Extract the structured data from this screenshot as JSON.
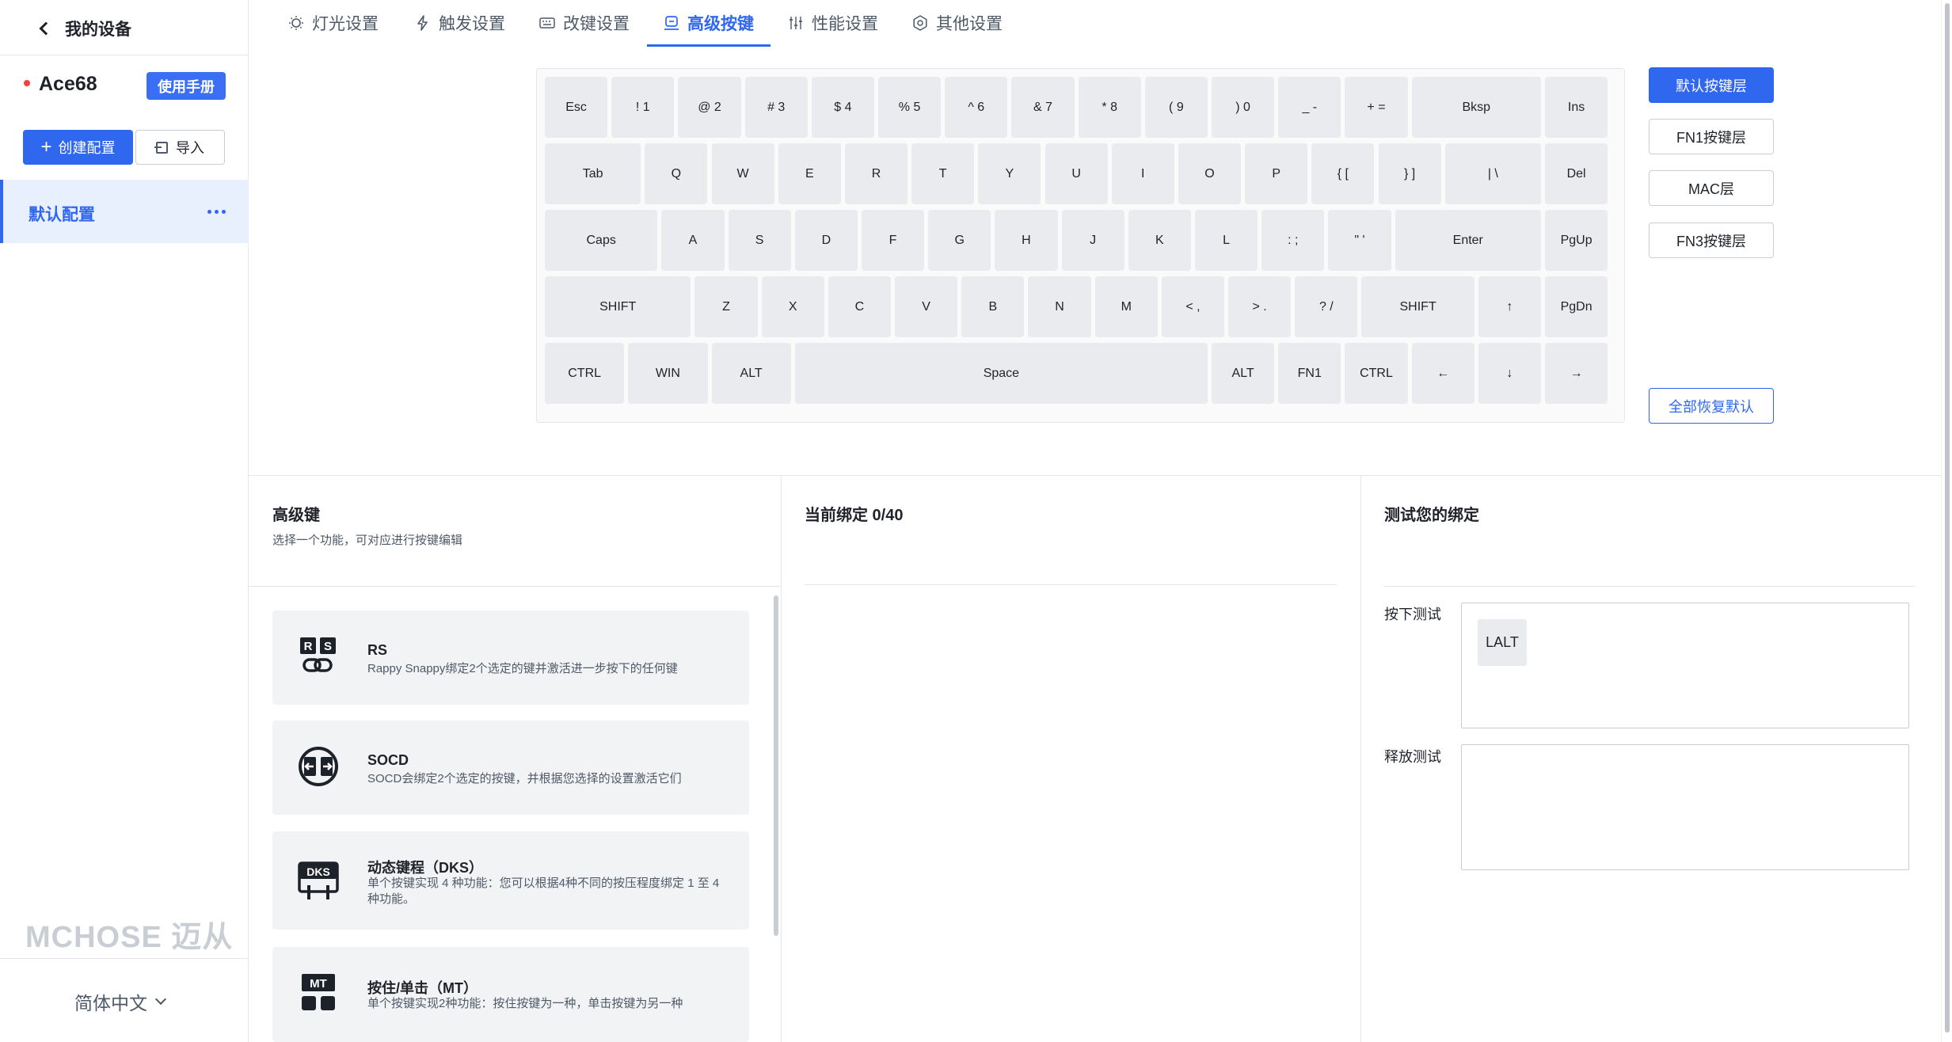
{
  "sidebar": {
    "back_label": "我的设备",
    "device_name": "Ace68",
    "manual_label": "使用手册",
    "create_label": "创建配置",
    "import_label": "导入",
    "config_item_label": "默认配置",
    "brand": "MCHOSE 迈从",
    "language": "简体中文"
  },
  "tabs": [
    {
      "label": "灯光设置",
      "icon": "lightbulb-icon"
    },
    {
      "label": "触发设置",
      "icon": "lightning-icon"
    },
    {
      "label": "改键设置",
      "icon": "keyboard-icon"
    },
    {
      "label": "高级按键",
      "icon": "advanced-key-icon",
      "active": true
    },
    {
      "label": "性能设置",
      "icon": "sliders-icon"
    },
    {
      "label": "其他设置",
      "icon": "settings-icon"
    }
  ],
  "keyboard": {
    "rows": [
      [
        "Esc",
        "! 1",
        "@ 2",
        "# 3",
        "$ 4",
        "% 5",
        "^ 6",
        "& 7",
        "* 8",
        "( 9",
        ") 0",
        "_ -",
        "+ =",
        "Bksp",
        "Ins"
      ],
      [
        "Tab",
        "Q",
        "W",
        "E",
        "R",
        "T",
        "Y",
        "U",
        "I",
        "O",
        "P",
        "{ [",
        "} ]",
        "| \\",
        "Del"
      ],
      [
        "Caps",
        "A",
        "S",
        "D",
        "F",
        "G",
        "H",
        "J",
        "K",
        "L",
        ": ;",
        "\" '",
        "Enter",
        "PgUp"
      ],
      [
        "SHIFT",
        "Z",
        "X",
        "C",
        "V",
        "B",
        "N",
        "M",
        "< ,",
        "> .",
        "? /",
        "SHIFT",
        "↑",
        "PgDn"
      ],
      [
        "CTRL",
        "WIN",
        "ALT",
        "Space",
        "ALT",
        "FN1",
        "CTRL",
        "←",
        "↓",
        "→"
      ]
    ]
  },
  "layers": {
    "items": [
      "默认按键层",
      "FN1按键层",
      "MAC层",
      "FN3按键层"
    ],
    "active": "默认按键层",
    "restore_label": "全部恢复默认"
  },
  "advanced": {
    "title": "高级键",
    "subtitle": "选择一个功能，可对应进行按键编辑",
    "cards": [
      {
        "icon": "rs-icon",
        "title": "RS",
        "desc": "Rappy Snappy绑定2个选定的键并激活进一步按下的任何键"
      },
      {
        "icon": "socd-icon",
        "title": "SOCD",
        "desc": "SOCD会绑定2个选定的按键，并根据您选择的设置激活它们"
      },
      {
        "icon": "dks-icon",
        "title": "动态键程（DKS）",
        "desc": "单个按键实现 4 种功能：您可以根据4种不同的按压程度绑定 1 至 4 种功能。"
      },
      {
        "icon": "mt-icon",
        "title": "按住/单击（MT）",
        "desc": "单个按键实现2种功能：按住按键为一种，单击按键为另一种"
      }
    ]
  },
  "binding": {
    "title": "当前绑定 0/40"
  },
  "test": {
    "title": "测试您的绑定",
    "press_label": "按下测试",
    "release_label": "释放测试",
    "pressed_keys": [
      "LALT"
    ]
  },
  "colors": {
    "accent": "#2f67ef",
    "key_bg": "#e9ebef",
    "dot": "#f53f3f"
  }
}
